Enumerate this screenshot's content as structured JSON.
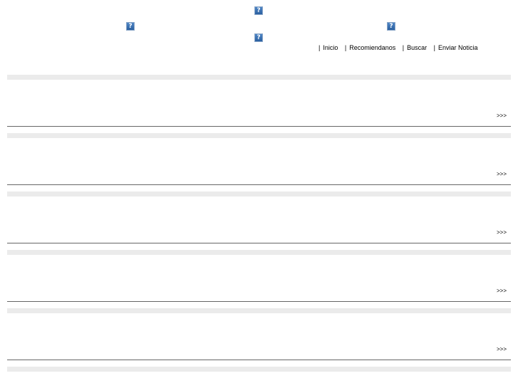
{
  "header": {
    "image_icon": "broken-image-icon",
    "image_glyph": "?"
  },
  "nav": {
    "separator": "|",
    "items": [
      {
        "label": "Inicio"
      },
      {
        "label": "Recomiendanos"
      },
      {
        "label": "Buscar"
      },
      {
        "label": "Enviar Noticia"
      }
    ]
  },
  "news": {
    "more_label": ">>>"
  },
  "colors": {
    "band": "#ebebeb",
    "rule": "#666666",
    "image_placeholder": "#3a6fb0"
  }
}
